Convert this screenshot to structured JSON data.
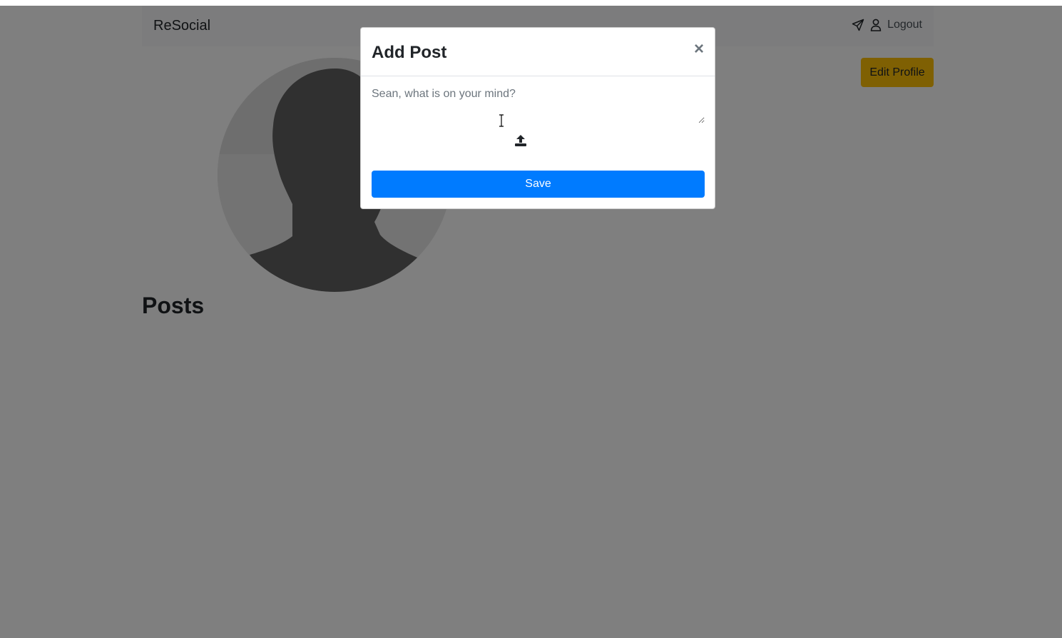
{
  "navbar": {
    "brand": "ReSocial",
    "logout_label": "Logout",
    "icons": [
      "paper-plane-icon",
      "user-icon"
    ]
  },
  "profile": {
    "edit_button_label": "Edit Profile",
    "avatar": "default-avatar-silhouette"
  },
  "posts": {
    "heading": "Posts"
  },
  "modal": {
    "title": "Add Post",
    "close_label": "×",
    "textarea_placeholder": "Sean, what is on your mind?",
    "upload_icon": "upload-icon",
    "save_label": "Save"
  },
  "colors": {
    "primary": "#007bff",
    "warning": "#ffc107",
    "navbar_bg": "#f8f9fa",
    "backdrop": "rgba(0,0,0,0.5)"
  }
}
